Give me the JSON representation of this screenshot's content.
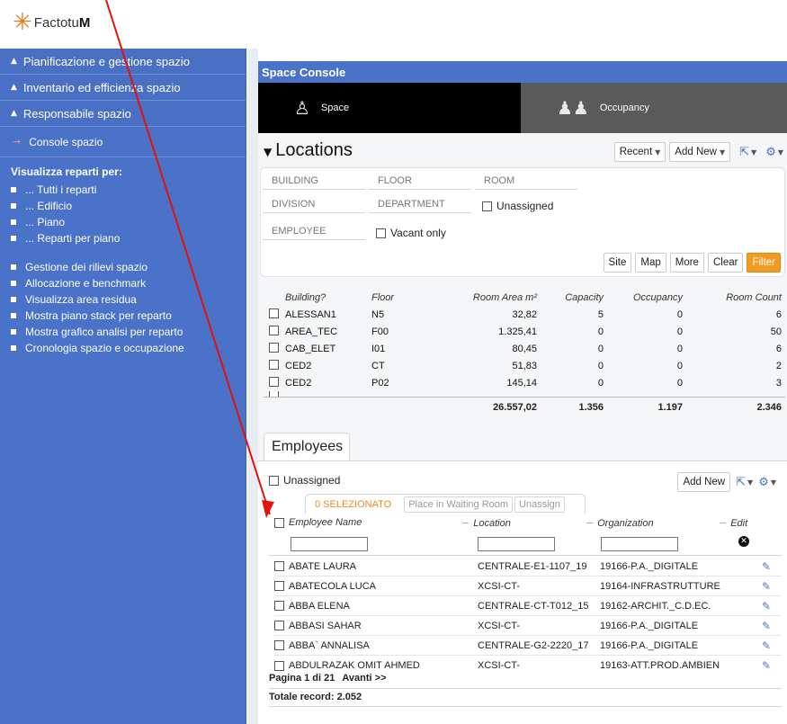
{
  "brand": {
    "logo_text_1": "Factotu",
    "logo_text_2": "M",
    "accent": "#4a72c9"
  },
  "nav": {
    "groups": [
      {
        "label": "Pianificazione e gestione spazio"
      },
      {
        "label": "Inventario ed efficienza spazio"
      },
      {
        "label": "Responsabile spazio"
      }
    ],
    "console_label": "Console spazio",
    "section_title": "Visualizza reparti per:",
    "view_items": [
      "... Tutti i reparti",
      "... Edificio",
      "... Piano",
      "... Reparti per piano"
    ],
    "other_items": [
      "Gestione dei rilievi spazio",
      "Allocazione e benchmark",
      "Visualizza area residua",
      "Mostra piano stack per reparto",
      "Mostra grafico analisi per reparto",
      "Cronologia spazio e occupazione"
    ]
  },
  "console": {
    "title": "Space Console",
    "tab_space": "Space",
    "tab_occupancy": "Occupancy"
  },
  "locations": {
    "title": "Locations",
    "recent": "Recent",
    "add_new": "Add New",
    "filters": {
      "building": "BUILDING",
      "floor": "FLOOR",
      "room": "ROOM",
      "division": "DIVISION",
      "department": "DEPARTMENT",
      "unassigned": "Unassigned",
      "employee": "EMPLOYEE",
      "vacant_only": "Vacant only"
    },
    "buttons": {
      "site": "Site",
      "map": "Map",
      "more": "More",
      "clear": "Clear",
      "filter": "Filter"
    },
    "columns": [
      "Building?",
      "Floor",
      "Room Area m²",
      "Capacity",
      "Occupancy",
      "Room Count"
    ],
    "rows": [
      {
        "building": "ALESSAN1",
        "floor": "N5",
        "area": "32,82",
        "capacity": "5",
        "occupancy": "0",
        "count": "6"
      },
      {
        "building": "AREA_TEC",
        "floor": "F00",
        "area": "1.325,41",
        "capacity": "0",
        "occupancy": "0",
        "count": "50"
      },
      {
        "building": "CAB_ELET",
        "floor": "I01",
        "area": "80,45",
        "capacity": "0",
        "occupancy": "0",
        "count": "6"
      },
      {
        "building": "CED2",
        "floor": "CT",
        "area": "51,83",
        "capacity": "0",
        "occupancy": "0",
        "count": "2"
      },
      {
        "building": "CED2",
        "floor": "P02",
        "area": "145,14",
        "capacity": "0",
        "occupancy": "0",
        "count": "3"
      }
    ],
    "totals": {
      "area": "26.557,02",
      "capacity": "1.356",
      "occupancy": "1.197",
      "count": "2.346"
    }
  },
  "employees": {
    "tab": "Employees",
    "unassigned": "Unassigned",
    "add_new": "Add New",
    "selected": "0 SELEZIONATO",
    "place_waiting": "Place in Waiting Room",
    "unassign": "Unassign",
    "columns": {
      "name": "Employee Name",
      "location": "Location",
      "organization": "Organization",
      "edit": "Edit"
    },
    "rows": [
      {
        "name": "ABATE LAURA",
        "location": "CENTRALE-E1-1107_19",
        "org": "19166-P.A._DIGITALE"
      },
      {
        "name": "ABATECOLA LUCA",
        "location": "XCSI-CT-",
        "org": "19164-INFRASTRUTTURE"
      },
      {
        "name": "ABBA ELENA",
        "location": "CENTRALE-CT-T012_15",
        "org": "19162-ARCHIT._C.D.EC."
      },
      {
        "name": "ABBASI SAHAR",
        "location": "XCSI-CT-",
        "org": "19166-P.A._DIGITALE"
      },
      {
        "name": "ABBA` ANNALISA",
        "location": "CENTRALE-G2-2220_17",
        "org": "19166-P.A._DIGITALE"
      },
      {
        "name": "ABDULRAZAK OMIT AHMED",
        "location": "XCSI-CT-",
        "org": "19163-ATT.PROD.AMBIEN"
      }
    ],
    "pager": "Pagina 1 di 21",
    "next": "Avanti >>",
    "total": "Totale record: 2.052"
  }
}
